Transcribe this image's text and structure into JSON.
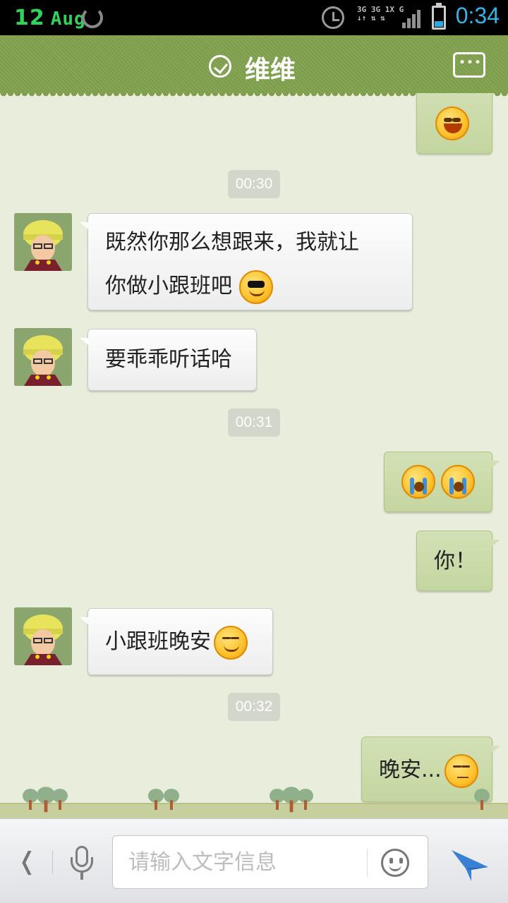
{
  "status_bar": {
    "day": "12",
    "month": "Aug",
    "net_lines": [
      "3G 3G 1X G",
      "↓↑ ⇅ ⇅"
    ],
    "time": "0:34"
  },
  "header": {
    "title": "维维",
    "verified_icon": "check-circle-icon",
    "menu_icon": "more-dots-icon"
  },
  "messages": [
    {
      "type": "outgoing",
      "text": "",
      "emoji": [
        "laugh"
      ]
    },
    {
      "type": "time",
      "text": "00:30"
    },
    {
      "type": "incoming",
      "lines": [
        "既然你那么想跟来，我就让",
        "你做小跟班吧"
      ],
      "emoji": [
        "cool"
      ]
    },
    {
      "type": "incoming",
      "text": "要乖乖听话哈"
    },
    {
      "type": "time",
      "text": "00:31"
    },
    {
      "type": "outgoing",
      "text": "",
      "emoji": [
        "cry",
        "cry"
      ]
    },
    {
      "type": "outgoing",
      "text": "你！"
    },
    {
      "type": "incoming",
      "text": "小跟班晚安",
      "emoji": [
        "smile"
      ]
    },
    {
      "type": "time",
      "text": "00:32"
    },
    {
      "type": "outgoing",
      "text": "晚安...",
      "emoji": [
        "meh"
      ]
    }
  ],
  "input_bar": {
    "back_label": "❬",
    "placeholder": "请输入文字信息",
    "mic_icon": "microphone-icon",
    "emoji_icon": "smiley-icon",
    "send_icon": "send-paper-plane-icon"
  },
  "colors": {
    "header_green": "#84a451",
    "chat_bg": "#e9eedc",
    "clock_blue": "#33b5e5",
    "date_green": "#2fd35a",
    "send_blue": "#3a7fd6"
  }
}
